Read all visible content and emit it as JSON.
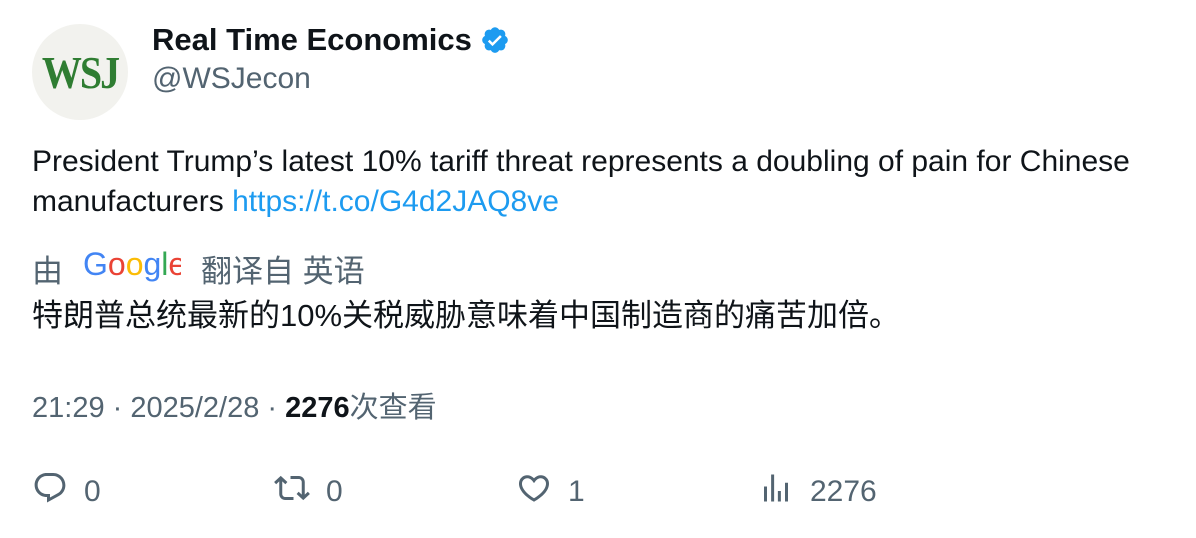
{
  "profile": {
    "avatar_text": "WSJ",
    "name": "Real Time Economics",
    "handle": "@WSJecon",
    "verified_icon": "verified-badge-icon",
    "colors": {
      "avatar_bg": "#f2f2ee",
      "avatar_text": "#2f7d32",
      "verified": "#1d9bf0"
    }
  },
  "tweet": {
    "text": "President Trump’s latest 10% tariff threat represents a doubling of pain for Chinese manufacturers ",
    "link": "https://t.co/G4d2JAQ8ve",
    "link_color": "#1d9bf0"
  },
  "translation": {
    "prefix": "由",
    "provider_logo": "Google",
    "suffix": "翻译自 英语",
    "text": "特朗普总统最新的10%关税威胁意味着中国制造商的痛苦加倍。"
  },
  "meta": {
    "time": "21:29",
    "sep1": " · ",
    "date": "2025/2/28",
    "sep2": " · ",
    "views_count": "2276",
    "views_label": "次查看"
  },
  "actions": {
    "reply": {
      "icon": "reply-icon",
      "count": "0"
    },
    "retweet": {
      "icon": "retweet-icon",
      "count": "0"
    },
    "like": {
      "icon": "heart-icon",
      "count": "1"
    },
    "views": {
      "icon": "analytics-icon",
      "count": "2276"
    }
  }
}
